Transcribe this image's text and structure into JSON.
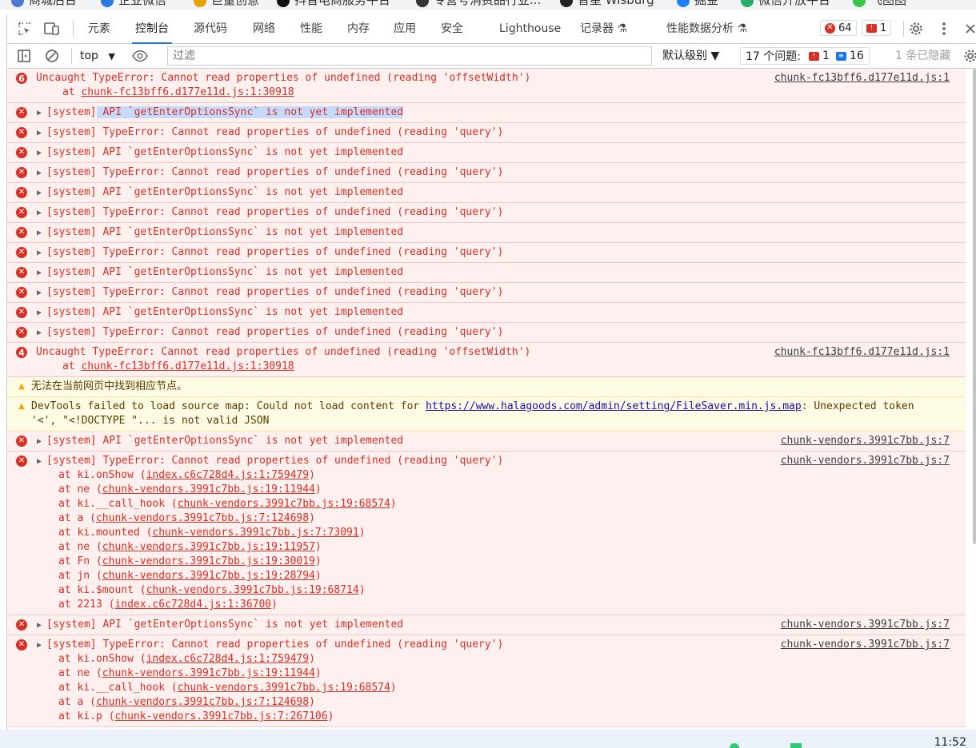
{
  "bookmarks": [
    "商城后台",
    "企业微信",
    "巨量创意",
    "抖音电商服务平台",
    "专营号消费品行业...",
    "智星 Wisburg",
    "掘金",
    "微信开放平台",
    "飞图图"
  ],
  "tabs": [
    "元素",
    "控制台",
    "源代码",
    "网络",
    "性能",
    "内存",
    "应用",
    "安全",
    "Lighthouse",
    "记录器 ⚗",
    "性能数据分析 ⚗"
  ],
  "counts": {
    "errors": "64",
    "warnings": "1"
  },
  "filter": {
    "context": "top",
    "placeholder": "过滤",
    "levels": "默认级别 ▼",
    "issues_label": "17 个问题:",
    "issues_err": "1",
    "issues_info": "16",
    "hidden": "1 条已隐藏"
  },
  "log": {
    "offset_err": "Uncaught TypeError: Cannot read properties of undefined (reading 'offsetWidth')",
    "offset_at": "at ",
    "offset_src": "chunk-fc13bff6.d177e11d.js:1:30918",
    "chunk_src": "chunk-fc13bff6.d177e11d.js:1",
    "count1": "6",
    "count2": "4",
    "sys_prefix": "[system]",
    "api_msg": " API `getEnterOptionsSync` is not yet implemented",
    "query_msg": " TypeError: Cannot read properties of undefined (reading 'query')",
    "warn1": "无法在当前网页中找到相应节点。",
    "warn2_a": "DevTools failed to load source map: Could not load content for ",
    "warn2_url": "https://www.halagoods.com/admin/setting/FileSaver.min.js.map",
    "warn2_b": ": Unexpected token '<', \"<!DOCTYPE \"... is not valid JSON",
    "vendors_src": "chunk-vendors.3991c7bb.js:7",
    "stack1": [
      {
        "fn": "at ki.onShow (",
        "file": "index.c6c728d4.js:1:759479",
        "end": ")"
      },
      {
        "fn": "at ne (",
        "file": "chunk-vendors.3991c7bb.js:19:11944",
        "end": ")"
      },
      {
        "fn": "at ki.__call_hook (",
        "file": "chunk-vendors.3991c7bb.js:19:68574",
        "end": ")"
      },
      {
        "fn": "at a (",
        "file": "chunk-vendors.3991c7bb.js:7:124698",
        "end": ")"
      },
      {
        "fn": "at ki.mounted (",
        "file": "chunk-vendors.3991c7bb.js:7:73091",
        "end": ")"
      },
      {
        "fn": "at ne (",
        "file": "chunk-vendors.3991c7bb.js:19:11957",
        "end": ")"
      },
      {
        "fn": "at Fn (",
        "file": "chunk-vendors.3991c7bb.js:19:30019",
        "end": ")"
      },
      {
        "fn": "at jn (",
        "file": "chunk-vendors.3991c7bb.js:19:28794",
        "end": ")"
      },
      {
        "fn": "at ki.$mount (",
        "file": "chunk-vendors.3991c7bb.js:19:68714",
        "end": ")"
      },
      {
        "fn": "at 2213 (",
        "file": "index.c6c728d4.js:1:36700",
        "end": ")"
      }
    ],
    "stack2": [
      {
        "fn": "at ki.onShow (",
        "file": "index.c6c728d4.js:1:759479",
        "end": ")"
      },
      {
        "fn": "at ne (",
        "file": "chunk-vendors.3991c7bb.js:19:11944",
        "end": ")"
      },
      {
        "fn": "at ki.__call_hook (",
        "file": "chunk-vendors.3991c7bb.js:19:68574",
        "end": ")"
      },
      {
        "fn": "at a (",
        "file": "chunk-vendors.3991c7bb.js:7:124698",
        "end": ")"
      },
      {
        "fn": "at ki.p (",
        "file": "chunk-vendors.3991c7bb.js:7:267106",
        "end": ")"
      }
    ]
  },
  "clock": "11:52"
}
